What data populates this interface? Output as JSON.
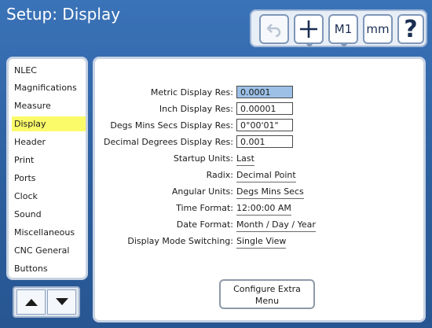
{
  "header": {
    "title": "Setup: Display"
  },
  "toolbar": {
    "m1_label": "M1",
    "mm_label": "mm",
    "help_label": "?"
  },
  "sidebar": {
    "items": [
      {
        "label": "NLEC"
      },
      {
        "label": "Magnifications"
      },
      {
        "label": "Measure"
      },
      {
        "label": "Display",
        "selected": true
      },
      {
        "label": "Header"
      },
      {
        "label": "Print"
      },
      {
        "label": "Ports"
      },
      {
        "label": "Clock"
      },
      {
        "label": "Sound"
      },
      {
        "label": "Miscellaneous"
      },
      {
        "label": "CNC General"
      },
      {
        "label": "Buttons"
      }
    ]
  },
  "settings": {
    "metric_res": {
      "label": "Metric Display Res:",
      "value": "0.0001"
    },
    "inch_res": {
      "label": "Inch Display Res:",
      "value": "0.00001"
    },
    "dms_res": {
      "label": "Degs Mins Secs Display Res:",
      "value": "0°00'01\""
    },
    "dd_res": {
      "label": "Decimal Degrees Display Res:",
      "value": "0.001"
    },
    "startup_units": {
      "label": "Startup Units:",
      "value": "Last"
    },
    "radix": {
      "label": "Radix:",
      "value": "Decimal Point"
    },
    "angular_units": {
      "label": "Angular Units:",
      "value": "Degs Mins Secs"
    },
    "time_format": {
      "label": "Time Format:",
      "value": "12:00:00 AM"
    },
    "date_format": {
      "label": "Date Format:",
      "value": "Month / Day / Year"
    },
    "display_mode": {
      "label": "Display Mode Switching:",
      "value": "Single View"
    }
  },
  "actions": {
    "configure_line1": "Configure Extra",
    "configure_line2": "Menu"
  },
  "colors": {
    "background": "#2f63a3",
    "selected_item": "#fbfb6a",
    "active_field": "#9cc0e6"
  }
}
